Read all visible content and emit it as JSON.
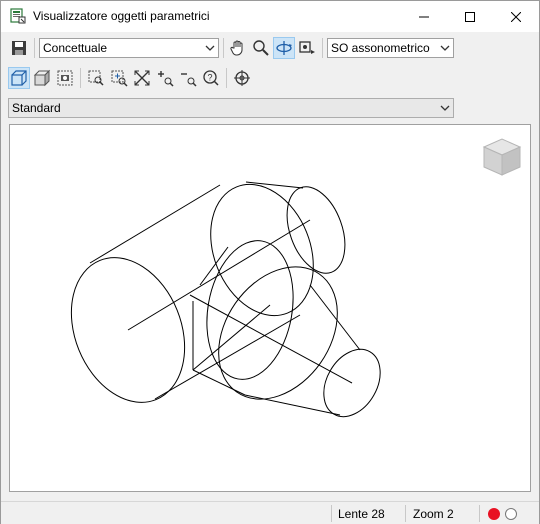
{
  "window": {
    "title": "Visualizzatore oggetti parametrici"
  },
  "toolbar": {
    "visual_style": "Concettuale",
    "view": "SO assonometrico",
    "standard": "Standard"
  },
  "statusbar": {
    "lens": "Lente 28",
    "zoom": "Zoom 2"
  },
  "icons": {
    "save": "save-icon",
    "pan": "hand-icon",
    "zoom": "magnifier-icon",
    "orbit": "orbit-icon",
    "camera": "camera-icon",
    "wireframe": "wireframe-cube-icon",
    "shaded": "shaded-cube-icon",
    "view_camera": "camera-settings-icon",
    "zoom_window": "zoom-window-icon",
    "zoom_dynamic": "zoom-dynamic-icon",
    "zoom_extents": "zoom-extents-icon",
    "zoom_in": "zoom-in-icon",
    "zoom_out": "zoom-out-icon",
    "help": "help-icon",
    "target": "crosshair-icon"
  },
  "colors": {
    "record_active": "#e81123",
    "accent_active": "#cce4f7"
  }
}
